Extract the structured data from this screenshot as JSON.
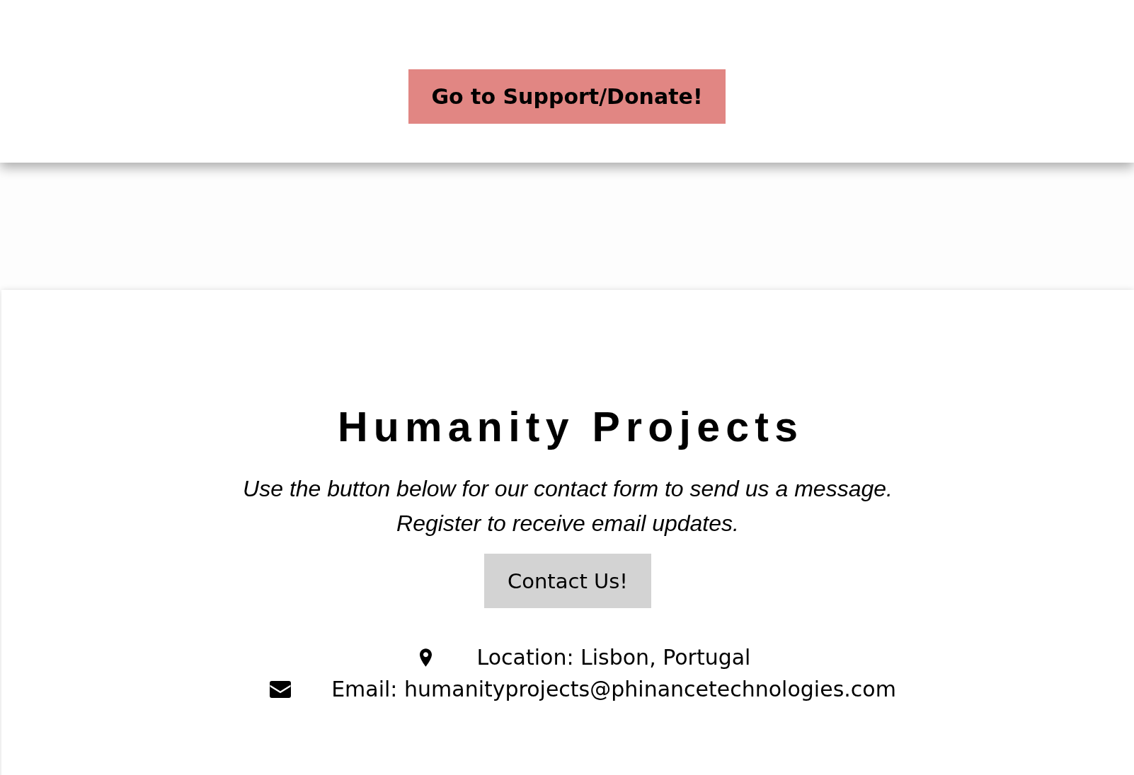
{
  "header": {
    "donate_button": "Go to Support/Donate!"
  },
  "contact_section": {
    "title": "Humanity Projects",
    "description": [
      "Use the button below for our contact form to send us a message.",
      "Register to receive email updates."
    ],
    "contact_button": "Contact Us!",
    "details": [
      {
        "kind": "location",
        "text": "Location: Lisbon, Portugal"
      },
      {
        "kind": "email",
        "text": "Email: humanityprojects@phinancetechnologies.com"
      }
    ]
  }
}
